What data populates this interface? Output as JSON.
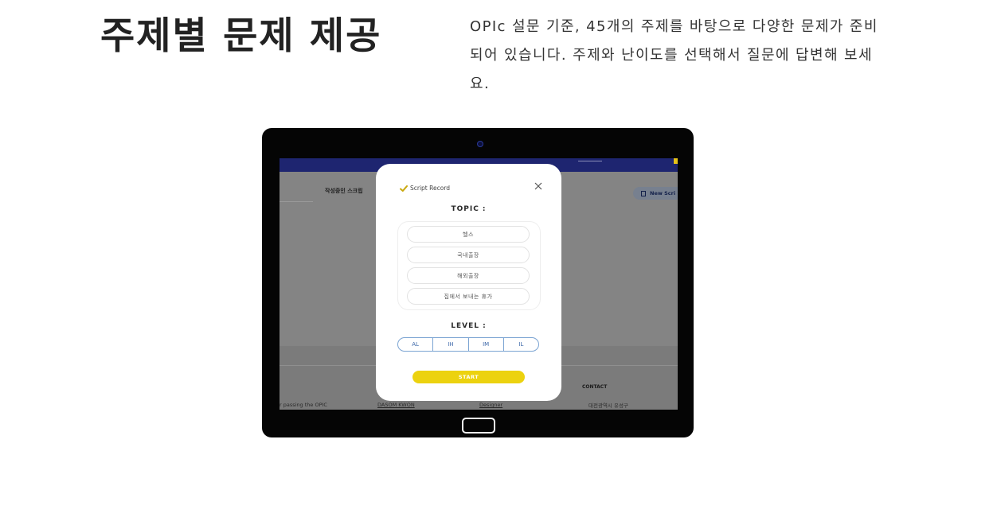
{
  "header": {
    "title": "주제별 문제 제공",
    "description": "OPIc 설문 기준, 45개의 주제를 바탕으로 다양한 문제가 준비되어 있습니다. 주제와 난이도를 선택해서 질문에 답변해 보세요."
  },
  "app_background": {
    "heading": "작성중인 스크립",
    "new_script_label": "New Scri",
    "footer": {
      "contact_label": "CONTACT",
      "address": "대전광역시 유성구",
      "tagline": "r passing the OPIC",
      "author_name": "DASOM KWON",
      "author_role": "Designer"
    }
  },
  "modal": {
    "title": "Script Record",
    "topic_label": "TOPIC :",
    "topics": [
      "헬스",
      "국내출장",
      "해외출장",
      "집에서 보내는 휴가"
    ],
    "level_label": "LEVEL :",
    "levels": [
      "AL",
      "IH",
      "IM",
      "IL"
    ],
    "start_label": "START"
  },
  "colors": {
    "accent_yellow": "#ecd20f",
    "navy_bar": "#1e2570",
    "level_blue": "#3a66a8",
    "overlay_gray": "#848484"
  },
  "icons": {
    "check": "check-icon",
    "close": "close-icon",
    "document": "document-icon",
    "camera": "camera-icon"
  }
}
